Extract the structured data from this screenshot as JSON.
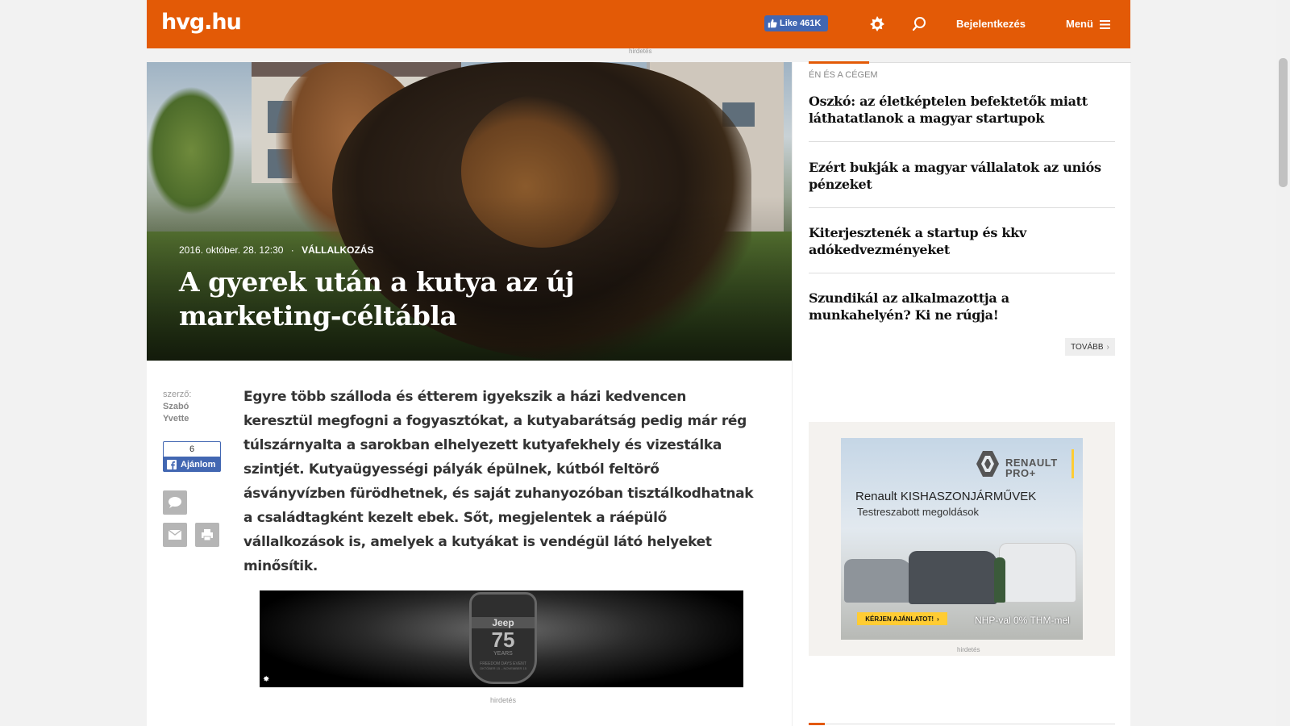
{
  "header": {
    "logo": "hvg.hu",
    "fb_like": "Like 461K",
    "login": "Bejelentkezés",
    "menu": "Menü",
    "accent_color": "#e35a06"
  },
  "ad_label": "hirdetés",
  "article": {
    "date": "2016. október. 28. 12:30",
    "separator": "·",
    "category": "VÁLLALKOZÁS",
    "title": "A gyerek után a kutya az új marketing-céltábla",
    "author_label": "szerző:",
    "author_name": "Szabó Yvette",
    "fb_count": "6",
    "fb_recommend": "Ajánlom",
    "lead": "Egyre több szálloda és étterem igyekszik a házi kedvencen keresztül megfogni a fogyasztókat, a kutyabarátság pedig már rég túlszárnyalta a sarokban elhelyezett kutyafekhely és vizestálka szintjét. Kutyaügyességi pályák épülnek, kútból feltörő ásványvízben fürödhetnek, és saját zuhanyozóban tisztálkodhatnak a családtagként kezelt ebek. Sőt, megjelentek a ráépülő vállalkozások is, amelyek a kutyákat is vendégül látó helyeket minősítik.",
    "icons": [
      "comment-icon",
      "email-icon",
      "print-icon"
    ]
  },
  "jeep_ad": {
    "brand": "Jeep",
    "number": "75",
    "years": "YEARS",
    "event": "FREEDOM DAYS EVENT",
    "dates": "OKTÓBER 15 – NOVEMBER 15"
  },
  "sidebar": {
    "category": "ÉN ÉS A CÉGEM",
    "items": [
      {
        "title": "Oszkó: az életképtelen befektetők miatt láthatatlanok a magyar startupok"
      },
      {
        "title": "Ezért bukják a magyar vállalatok az uniós pénzeket"
      },
      {
        "title": "Kiterjesztenék a startup és kkv adókedvezményeket"
      },
      {
        "title": "Szundikál az alkalmazottja a munkahelyén? Ki ne rúgja!"
      }
    ],
    "more": "TOVÁBB"
  },
  "renault_ad": {
    "brand_line1": "RENAULT",
    "brand_line2": "PRO+",
    "headline": "Renault KISHASZONJÁRMŰVEK",
    "subline": "Testreszabott megoldások",
    "cta": "KÉRJEN AJÁNLATOT!",
    "footnote": "NHP-val 0% THM-mel"
  }
}
